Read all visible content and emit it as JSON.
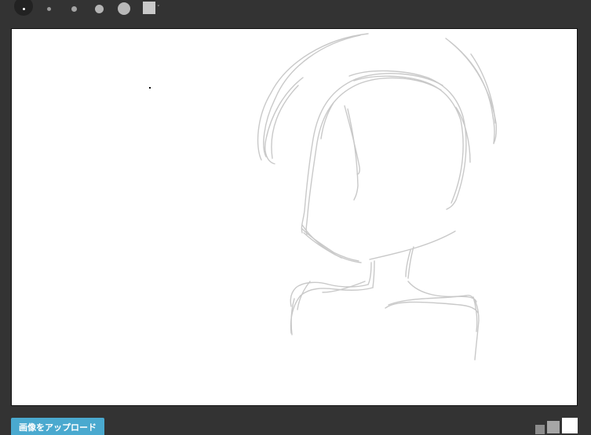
{
  "toolbar": {
    "brushes": [
      {
        "name": "brush-size-1",
        "active": true
      },
      {
        "name": "brush-size-2",
        "active": false
      },
      {
        "name": "brush-size-3",
        "active": false
      },
      {
        "name": "brush-size-4",
        "active": false
      },
      {
        "name": "brush-size-5",
        "active": false
      }
    ],
    "color_picker": {
      "color": "#c9c9c9",
      "caret": "˅"
    }
  },
  "canvas": {
    "background": "#ffffff",
    "stroke_color": "#c9c9c9",
    "dot_color": "#000000"
  },
  "footer": {
    "upload_label": "画像をアップロード",
    "upload_color": "#4aa9cf",
    "canvas_sizes": [
      "small",
      "medium",
      "large"
    ]
  }
}
